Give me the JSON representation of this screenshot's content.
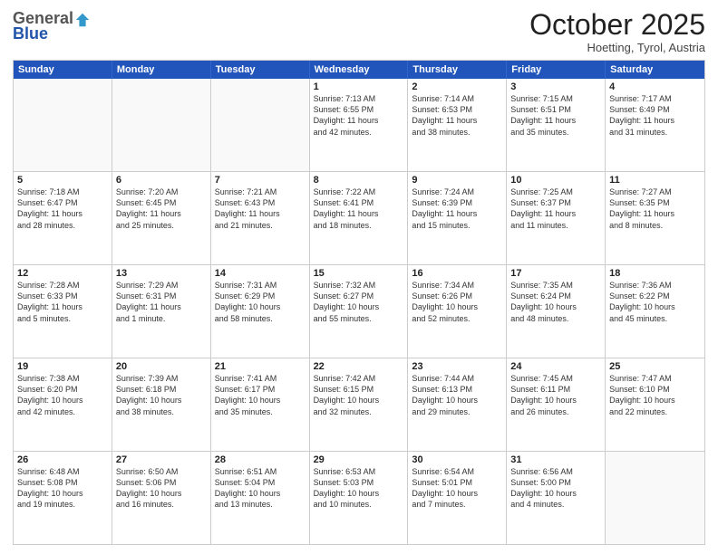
{
  "logo": {
    "general": "General",
    "blue": "Blue"
  },
  "header": {
    "month": "October 2025",
    "location": "Hoetting, Tyrol, Austria"
  },
  "weekdays": [
    "Sunday",
    "Monday",
    "Tuesday",
    "Wednesday",
    "Thursday",
    "Friday",
    "Saturday"
  ],
  "rows": [
    [
      {
        "day": "",
        "lines": [],
        "empty": true
      },
      {
        "day": "",
        "lines": [],
        "empty": true
      },
      {
        "day": "",
        "lines": [],
        "empty": true
      },
      {
        "day": "1",
        "lines": [
          "Sunrise: 7:13 AM",
          "Sunset: 6:55 PM",
          "Daylight: 11 hours",
          "and 42 minutes."
        ]
      },
      {
        "day": "2",
        "lines": [
          "Sunrise: 7:14 AM",
          "Sunset: 6:53 PM",
          "Daylight: 11 hours",
          "and 38 minutes."
        ]
      },
      {
        "day": "3",
        "lines": [
          "Sunrise: 7:15 AM",
          "Sunset: 6:51 PM",
          "Daylight: 11 hours",
          "and 35 minutes."
        ]
      },
      {
        "day": "4",
        "lines": [
          "Sunrise: 7:17 AM",
          "Sunset: 6:49 PM",
          "Daylight: 11 hours",
          "and 31 minutes."
        ]
      }
    ],
    [
      {
        "day": "5",
        "lines": [
          "Sunrise: 7:18 AM",
          "Sunset: 6:47 PM",
          "Daylight: 11 hours",
          "and 28 minutes."
        ]
      },
      {
        "day": "6",
        "lines": [
          "Sunrise: 7:20 AM",
          "Sunset: 6:45 PM",
          "Daylight: 11 hours",
          "and 25 minutes."
        ]
      },
      {
        "day": "7",
        "lines": [
          "Sunrise: 7:21 AM",
          "Sunset: 6:43 PM",
          "Daylight: 11 hours",
          "and 21 minutes."
        ]
      },
      {
        "day": "8",
        "lines": [
          "Sunrise: 7:22 AM",
          "Sunset: 6:41 PM",
          "Daylight: 11 hours",
          "and 18 minutes."
        ]
      },
      {
        "day": "9",
        "lines": [
          "Sunrise: 7:24 AM",
          "Sunset: 6:39 PM",
          "Daylight: 11 hours",
          "and 15 minutes."
        ]
      },
      {
        "day": "10",
        "lines": [
          "Sunrise: 7:25 AM",
          "Sunset: 6:37 PM",
          "Daylight: 11 hours",
          "and 11 minutes."
        ]
      },
      {
        "day": "11",
        "lines": [
          "Sunrise: 7:27 AM",
          "Sunset: 6:35 PM",
          "Daylight: 11 hours",
          "and 8 minutes."
        ]
      }
    ],
    [
      {
        "day": "12",
        "lines": [
          "Sunrise: 7:28 AM",
          "Sunset: 6:33 PM",
          "Daylight: 11 hours",
          "and 5 minutes."
        ]
      },
      {
        "day": "13",
        "lines": [
          "Sunrise: 7:29 AM",
          "Sunset: 6:31 PM",
          "Daylight: 11 hours",
          "and 1 minute."
        ]
      },
      {
        "day": "14",
        "lines": [
          "Sunrise: 7:31 AM",
          "Sunset: 6:29 PM",
          "Daylight: 10 hours",
          "and 58 minutes."
        ]
      },
      {
        "day": "15",
        "lines": [
          "Sunrise: 7:32 AM",
          "Sunset: 6:27 PM",
          "Daylight: 10 hours",
          "and 55 minutes."
        ]
      },
      {
        "day": "16",
        "lines": [
          "Sunrise: 7:34 AM",
          "Sunset: 6:26 PM",
          "Daylight: 10 hours",
          "and 52 minutes."
        ]
      },
      {
        "day": "17",
        "lines": [
          "Sunrise: 7:35 AM",
          "Sunset: 6:24 PM",
          "Daylight: 10 hours",
          "and 48 minutes."
        ]
      },
      {
        "day": "18",
        "lines": [
          "Sunrise: 7:36 AM",
          "Sunset: 6:22 PM",
          "Daylight: 10 hours",
          "and 45 minutes."
        ]
      }
    ],
    [
      {
        "day": "19",
        "lines": [
          "Sunrise: 7:38 AM",
          "Sunset: 6:20 PM",
          "Daylight: 10 hours",
          "and 42 minutes."
        ]
      },
      {
        "day": "20",
        "lines": [
          "Sunrise: 7:39 AM",
          "Sunset: 6:18 PM",
          "Daylight: 10 hours",
          "and 38 minutes."
        ]
      },
      {
        "day": "21",
        "lines": [
          "Sunrise: 7:41 AM",
          "Sunset: 6:17 PM",
          "Daylight: 10 hours",
          "and 35 minutes."
        ]
      },
      {
        "day": "22",
        "lines": [
          "Sunrise: 7:42 AM",
          "Sunset: 6:15 PM",
          "Daylight: 10 hours",
          "and 32 minutes."
        ]
      },
      {
        "day": "23",
        "lines": [
          "Sunrise: 7:44 AM",
          "Sunset: 6:13 PM",
          "Daylight: 10 hours",
          "and 29 minutes."
        ]
      },
      {
        "day": "24",
        "lines": [
          "Sunrise: 7:45 AM",
          "Sunset: 6:11 PM",
          "Daylight: 10 hours",
          "and 26 minutes."
        ]
      },
      {
        "day": "25",
        "lines": [
          "Sunrise: 7:47 AM",
          "Sunset: 6:10 PM",
          "Daylight: 10 hours",
          "and 22 minutes."
        ]
      }
    ],
    [
      {
        "day": "26",
        "lines": [
          "Sunrise: 6:48 AM",
          "Sunset: 5:08 PM",
          "Daylight: 10 hours",
          "and 19 minutes."
        ]
      },
      {
        "day": "27",
        "lines": [
          "Sunrise: 6:50 AM",
          "Sunset: 5:06 PM",
          "Daylight: 10 hours",
          "and 16 minutes."
        ]
      },
      {
        "day": "28",
        "lines": [
          "Sunrise: 6:51 AM",
          "Sunset: 5:04 PM",
          "Daylight: 10 hours",
          "and 13 minutes."
        ]
      },
      {
        "day": "29",
        "lines": [
          "Sunrise: 6:53 AM",
          "Sunset: 5:03 PM",
          "Daylight: 10 hours",
          "and 10 minutes."
        ]
      },
      {
        "day": "30",
        "lines": [
          "Sunrise: 6:54 AM",
          "Sunset: 5:01 PM",
          "Daylight: 10 hours",
          "and 7 minutes."
        ]
      },
      {
        "day": "31",
        "lines": [
          "Sunrise: 6:56 AM",
          "Sunset: 5:00 PM",
          "Daylight: 10 hours",
          "and 4 minutes."
        ]
      },
      {
        "day": "",
        "lines": [],
        "empty": true
      }
    ]
  ]
}
